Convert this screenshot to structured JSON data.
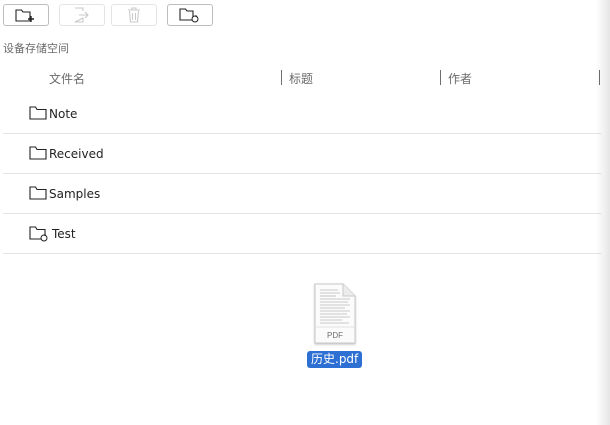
{
  "toolbar": {
    "buttons": [
      {
        "icon": "new-folder-icon",
        "enabled": true
      },
      {
        "icon": "export-icon",
        "enabled": false
      },
      {
        "icon": "trash-icon",
        "enabled": false
      },
      {
        "icon": "folder-sync-icon",
        "enabled": true
      }
    ]
  },
  "section_label": "设备存储空间",
  "columns": {
    "filename": "文件名",
    "title": "标题",
    "author": "作者"
  },
  "rows": [
    {
      "name": "Note",
      "icon": "folder-icon"
    },
    {
      "name": "Received",
      "icon": "folder-icon"
    },
    {
      "name": "Samples",
      "icon": "folder-icon"
    },
    {
      "name": "Test",
      "icon": "sync-folder-icon"
    }
  ],
  "file": {
    "name": "历史.pdf",
    "type_label": "PDF",
    "selected": true
  },
  "colors": {
    "selection": "#2d6fd2",
    "border": "#bdbdbd",
    "divider": "#e4e4e4"
  }
}
